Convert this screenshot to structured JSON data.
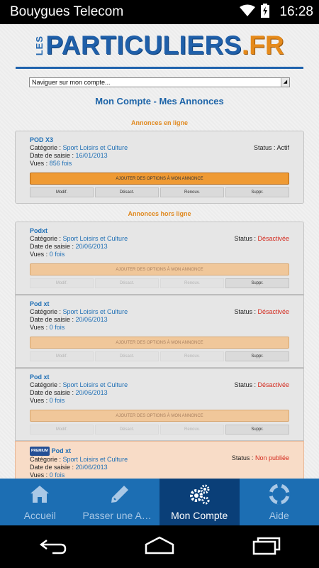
{
  "status_bar": {
    "carrier": "Bouygues Telecom",
    "time": "16:28"
  },
  "logo": {
    "prefix": "LES",
    "name": "PARTICULIERS",
    "tld": ".FR"
  },
  "nav_select": {
    "value": "Naviguer sur mon compte..."
  },
  "page_title": "Mon Compte - Mes Annonces",
  "sections": {
    "online": "Annonces en ligne",
    "offline": "Annonces hors ligne"
  },
  "labels": {
    "category": "Catégorie : ",
    "date": "Date de saisie : ",
    "views": "Vues : ",
    "status": "Status : ",
    "options_button": "AJOUTER DES OPTIONS À MON ANNONCE",
    "modify": "Modif.",
    "deactivate": "Désact.",
    "renew": "Renouv.",
    "delete": "Suppr."
  },
  "online_ads": [
    {
      "title": "POD X3",
      "category": "Sport Loisirs et Culture",
      "date": "16/01/2013",
      "views": "856 fois",
      "status": "Actif"
    }
  ],
  "offline_ads": [
    {
      "title": "Podxt",
      "category": "Sport Loisirs et Culture",
      "date": "20/06/2013",
      "views": "0 fois",
      "status": "Désactivée"
    },
    {
      "title": "Pod xt",
      "category": "Sport Loisirs et Culture",
      "date": "20/06/2013",
      "views": "0 fois",
      "status": "Désactivée"
    },
    {
      "title": "Pod xt",
      "category": "Sport Loisirs et Culture",
      "date": "20/06/2013",
      "views": "0 fois",
      "status": "Désactivée"
    },
    {
      "badge": "PREMIUM",
      "title": "Pod xt",
      "category": "Sport Loisirs et Culture",
      "date": "20/06/2013",
      "views": "0 fois",
      "status": "Non publiée"
    }
  ],
  "tabs": [
    {
      "label": "Accueil",
      "icon": "home-icon"
    },
    {
      "label": "Passer une Annonce",
      "icon": "pencil-icon"
    },
    {
      "label": "Mon Compte",
      "icon": "gears-icon",
      "active": true
    },
    {
      "label": "Aide",
      "icon": "lifebuoy-icon"
    }
  ],
  "colors": {
    "brand_blue": "#1f62ad",
    "accent_orange": "#ef9a33",
    "status_red": "#d42a1e",
    "tab_active": "#0a3f78"
  }
}
